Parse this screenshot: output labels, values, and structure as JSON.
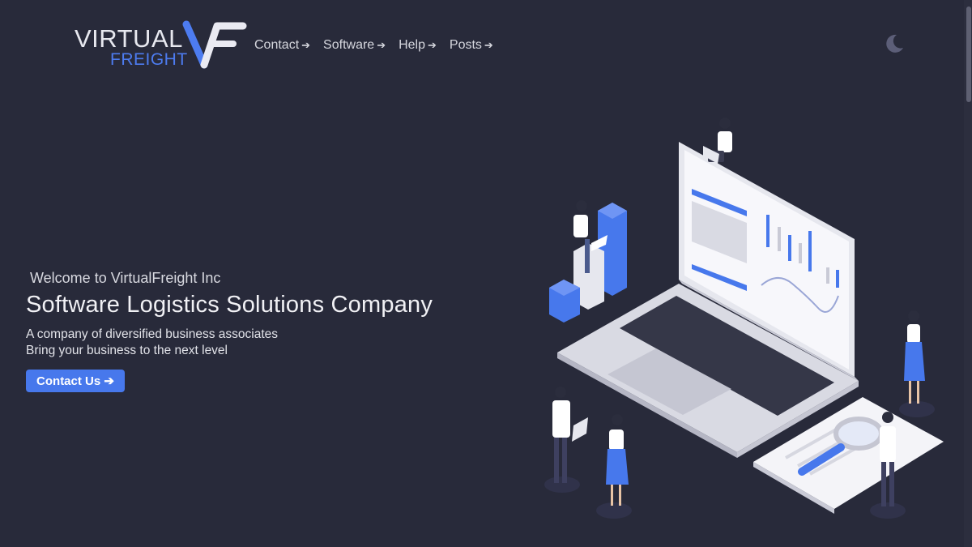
{
  "brand": {
    "line1": "VIRTUAL",
    "line2": "FREIGHT",
    "accent_color": "#4d7cf0"
  },
  "nav": {
    "items": [
      {
        "label": "Contact",
        "arrow": "➔"
      },
      {
        "label": "Software",
        "arrow": "➔"
      },
      {
        "label": "Help",
        "arrow": "➔"
      },
      {
        "label": "Posts",
        "arrow": "➔"
      }
    ]
  },
  "theme_toggle": {
    "icon": "moon-icon"
  },
  "hero": {
    "welcome": "Welcome to VirtualFreight Inc",
    "headline": "Software Logistics Solutions Company",
    "subtitle_line1": "A company of diversified business associates",
    "subtitle_line2": "Bring your business to the next level",
    "cta_label": "Contact Us ➔"
  },
  "colors": {
    "background": "#282a3a",
    "primary": "#4778ec"
  }
}
